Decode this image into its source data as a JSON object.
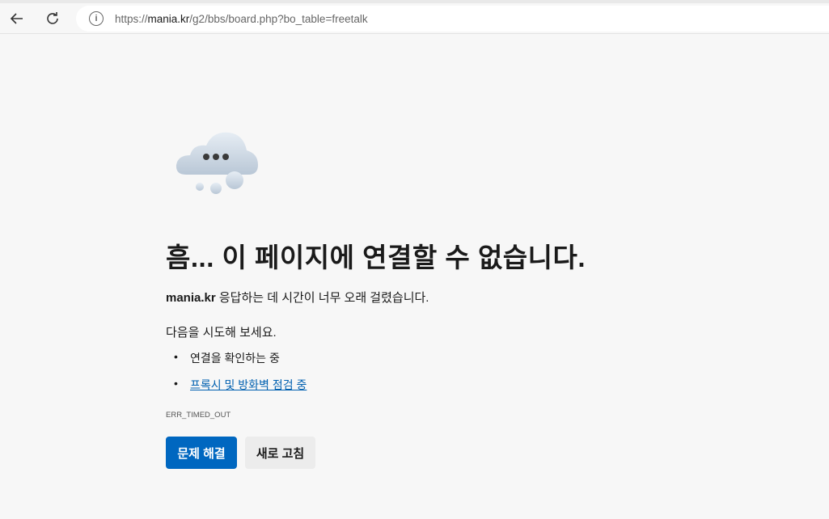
{
  "browser": {
    "url_prefix": "https://",
    "url_host": "mania.kr",
    "url_path": "/g2/bbs/board.php?bo_table=freetalk",
    "icons": [
      "back-arrow-icon",
      "refresh-icon",
      "info-icon"
    ]
  },
  "error": {
    "title": "흠... 이 페이지에 연결할 수 없습니다.",
    "host": "mania.kr",
    "message": " 응답하는 데 시간이 너무 오래 걸렸습니다.",
    "try_heading": "다음을 시도해 보세요.",
    "suggestions": [
      "연결을 확인하는 중",
      "프록시 및 방화벽 점검 중"
    ],
    "code": "ERR_TIMED_OUT",
    "buttons": {
      "troubleshoot": "문제 해결",
      "refresh": "새로 고침"
    }
  },
  "colors": {
    "primary": "#0067c0",
    "link": "#0060b0"
  }
}
